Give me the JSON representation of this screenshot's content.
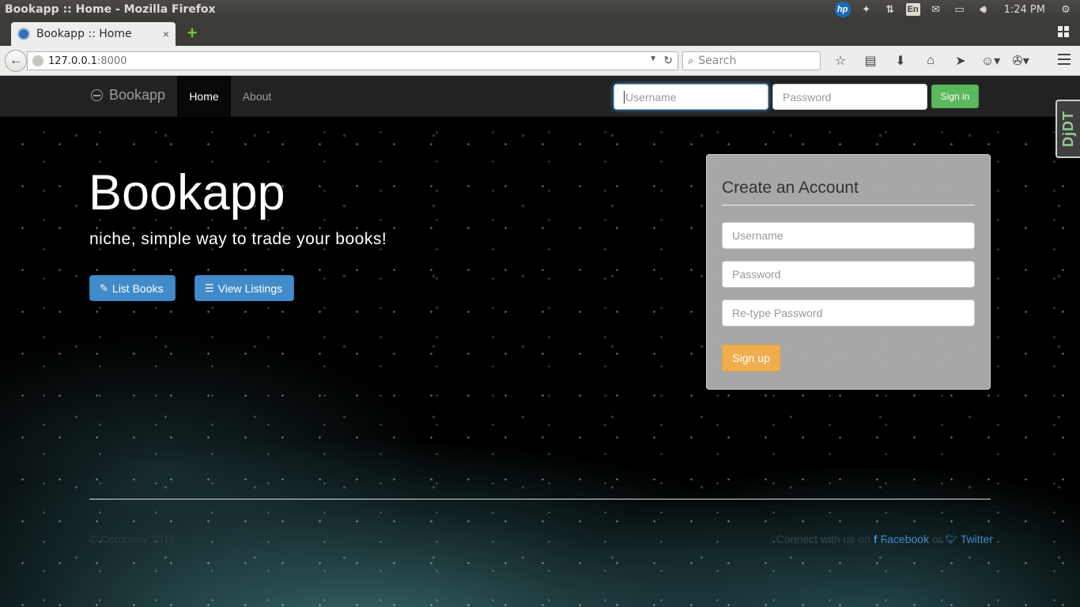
{
  "os": {
    "window_title": "Bookapp :: Home - Mozilla Firefox",
    "tray": {
      "hp_label": "hp",
      "lang": "En",
      "time": "1:24 PM"
    }
  },
  "browser": {
    "tab_title": "Bookapp :: Home",
    "tab_close": "×",
    "new_tab": "+",
    "url_host": "127.0.0.1",
    "url_port": ":8000",
    "search_placeholder": "Search",
    "toolbar_icons": [
      "bookmark-star-icon",
      "reading-list-icon",
      "download-icon",
      "home-icon",
      "send-icon",
      "addon-monkey-icon",
      "addon-extension-icon"
    ]
  },
  "site": {
    "brand": "Bookapp",
    "nav": {
      "home": "Home",
      "about": "About"
    },
    "login": {
      "username_placeholder": "Username",
      "password_placeholder": "Password",
      "signin": "Sign in"
    },
    "hero": {
      "title": "Bookapp",
      "subtitle": "niche, simple way to trade your books!",
      "list_books": "List Books",
      "view_listings": "View Listings"
    },
    "signup": {
      "title": "Create an Account",
      "username_placeholder": "Username",
      "password_placeholder": "Password",
      "retype_placeholder": "Re-type Password",
      "button": "Sign up"
    },
    "footer": {
      "copyright": "© Company 2015",
      "connect_text": "Connect with us on",
      "facebook": "Facebook",
      "or": "or",
      "twitter": "Twitter"
    },
    "debug_tab": "DjDT"
  }
}
